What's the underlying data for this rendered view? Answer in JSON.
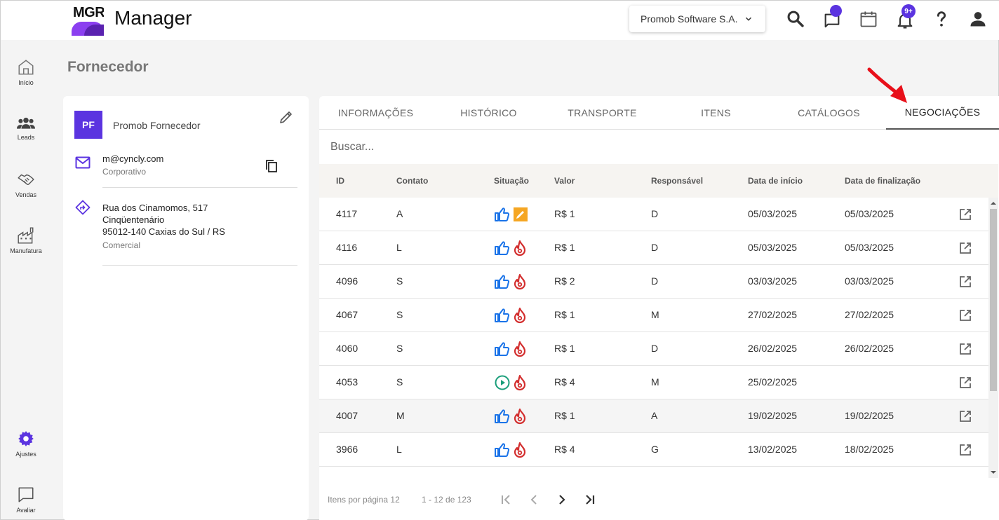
{
  "header": {
    "logo_text": "MGR",
    "app_name": "Manager",
    "company": "Promob Software S.A.",
    "notif_badge": "9+",
    "icons": [
      "search-icon",
      "chat-icon",
      "calendar-icon",
      "bell-icon",
      "help-icon",
      "user-icon"
    ]
  },
  "sidebar": {
    "items": [
      {
        "label": "Início",
        "icon": "home-icon"
      },
      {
        "label": "Leads",
        "icon": "people-icon"
      },
      {
        "label": "Vendas",
        "icon": "handshake-icon"
      },
      {
        "label": "Manufatura",
        "icon": "factory-icon"
      },
      {
        "label": "Ajustes",
        "icon": "gear-icon"
      },
      {
        "label": "Avaliar",
        "icon": "feedback-icon"
      }
    ]
  },
  "page": {
    "title": "Fornecedor"
  },
  "supplier": {
    "initials": "PF",
    "name": "Promob Fornecedor",
    "email": "m@cyncly.com",
    "email_type": "Corporativo",
    "address_line1": "Rua dos Cinamomos, 517",
    "address_line2": "Cinqüentenário",
    "address_line3": "95012-140 Caxias do Sul / RS",
    "address_type": "Comercial"
  },
  "tabs": [
    "INFORMAÇÕES",
    "HISTÓRICO",
    "TRANSPORTE",
    "ITENS",
    "CATÁLOGOS",
    "NEGOCIAÇÕES"
  ],
  "active_tab": "NEGOCIAÇÕES",
  "search": {
    "placeholder": "Buscar..."
  },
  "table": {
    "headers": [
      "ID",
      "Contato",
      "Situação",
      "Valor",
      "Responsável",
      "Data de início",
      "Data de finalização"
    ],
    "rows": [
      {
        "id": "4117",
        "contato": "A",
        "status": "approved",
        "temp": "edit",
        "valor": "R$ 1",
        "resp": "D",
        "inicio": "05/03/2025",
        "fim": "05/03/2025"
      },
      {
        "id": "4116",
        "contato": "L",
        "status": "approved",
        "temp": "hot",
        "valor": "R$ 1",
        "resp": "D",
        "inicio": "05/03/2025",
        "fim": "05/03/2025"
      },
      {
        "id": "4096",
        "contato": "S",
        "status": "approved",
        "temp": "hot",
        "valor": "R$ 2",
        "resp": "D",
        "inicio": "03/03/2025",
        "fim": "03/03/2025"
      },
      {
        "id": "4067",
        "contato": "S",
        "status": "approved",
        "temp": "hot",
        "valor": "R$ 1",
        "resp": "M",
        "inicio": "27/02/2025",
        "fim": "27/02/2025"
      },
      {
        "id": "4060",
        "contato": "S",
        "status": "approved",
        "temp": "hot",
        "valor": "R$ 1",
        "resp": "D",
        "inicio": "26/02/2025",
        "fim": "26/02/2025"
      },
      {
        "id": "4053",
        "contato": "S",
        "status": "in-progress",
        "temp": "hot",
        "valor": "R$ 4",
        "resp": "M",
        "inicio": "25/02/2025",
        "fim": ""
      },
      {
        "id": "4007",
        "contato": "M",
        "status": "approved",
        "temp": "hot",
        "valor": "R$ 1",
        "resp": "A",
        "inicio": "19/02/2025",
        "fim": "19/02/2025"
      },
      {
        "id": "3966",
        "contato": "L",
        "status": "approved",
        "temp": "hot",
        "valor": "R$ 4",
        "resp": "G",
        "inicio": "13/02/2025",
        "fim": "18/02/2025"
      }
    ]
  },
  "pagination": {
    "per_page_label": "Itens por página 12",
    "range": "1 - 12 de 123"
  },
  "colors": {
    "accent": "#5b34e0",
    "thumb_blue": "#1a73e8",
    "hot_red": "#d32f2f",
    "edit_orange": "#f5a623",
    "progress_green": "#1a9e7a"
  }
}
